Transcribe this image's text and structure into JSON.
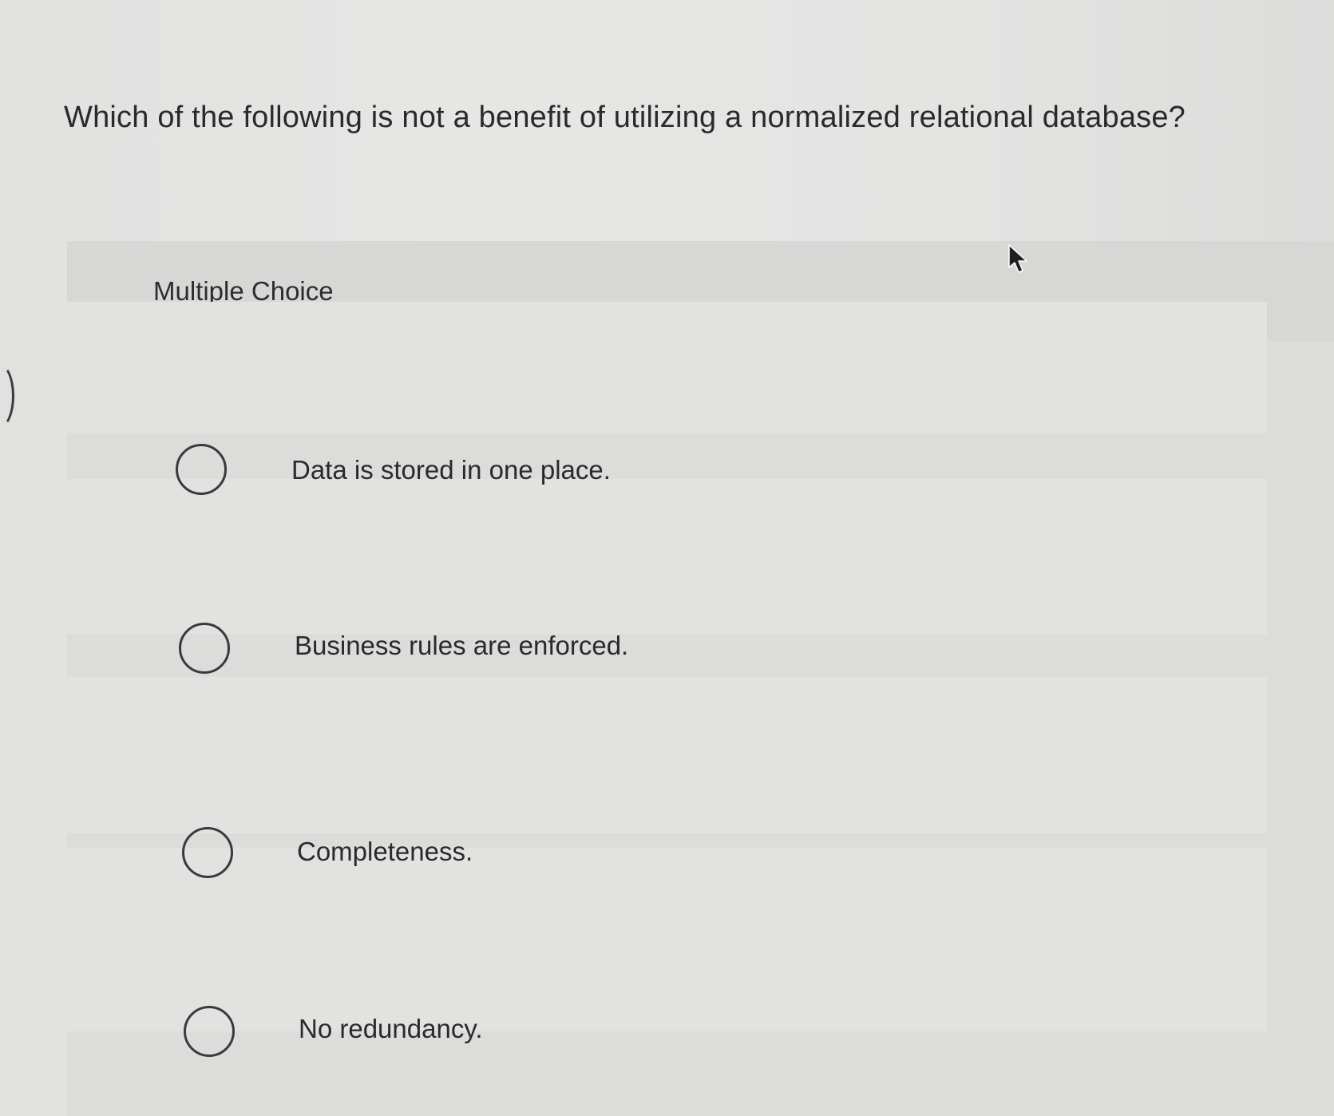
{
  "question": {
    "text": "Which of the following is not a benefit of utilizing a normalized relational database?"
  },
  "section": {
    "label": "Multiple Choice"
  },
  "options": [
    {
      "label": "Data is stored in one place."
    },
    {
      "label": "Business rules are enforced."
    },
    {
      "label": "Completeness."
    },
    {
      "label": "No redundancy."
    }
  ],
  "colors": {
    "background": "#e3e3e2",
    "panel": "#d9d9d8",
    "text": "#2a2a2a",
    "radio_border": "#3a3a3a"
  },
  "icons": {
    "cursor": "mouse-pointer-icon"
  }
}
